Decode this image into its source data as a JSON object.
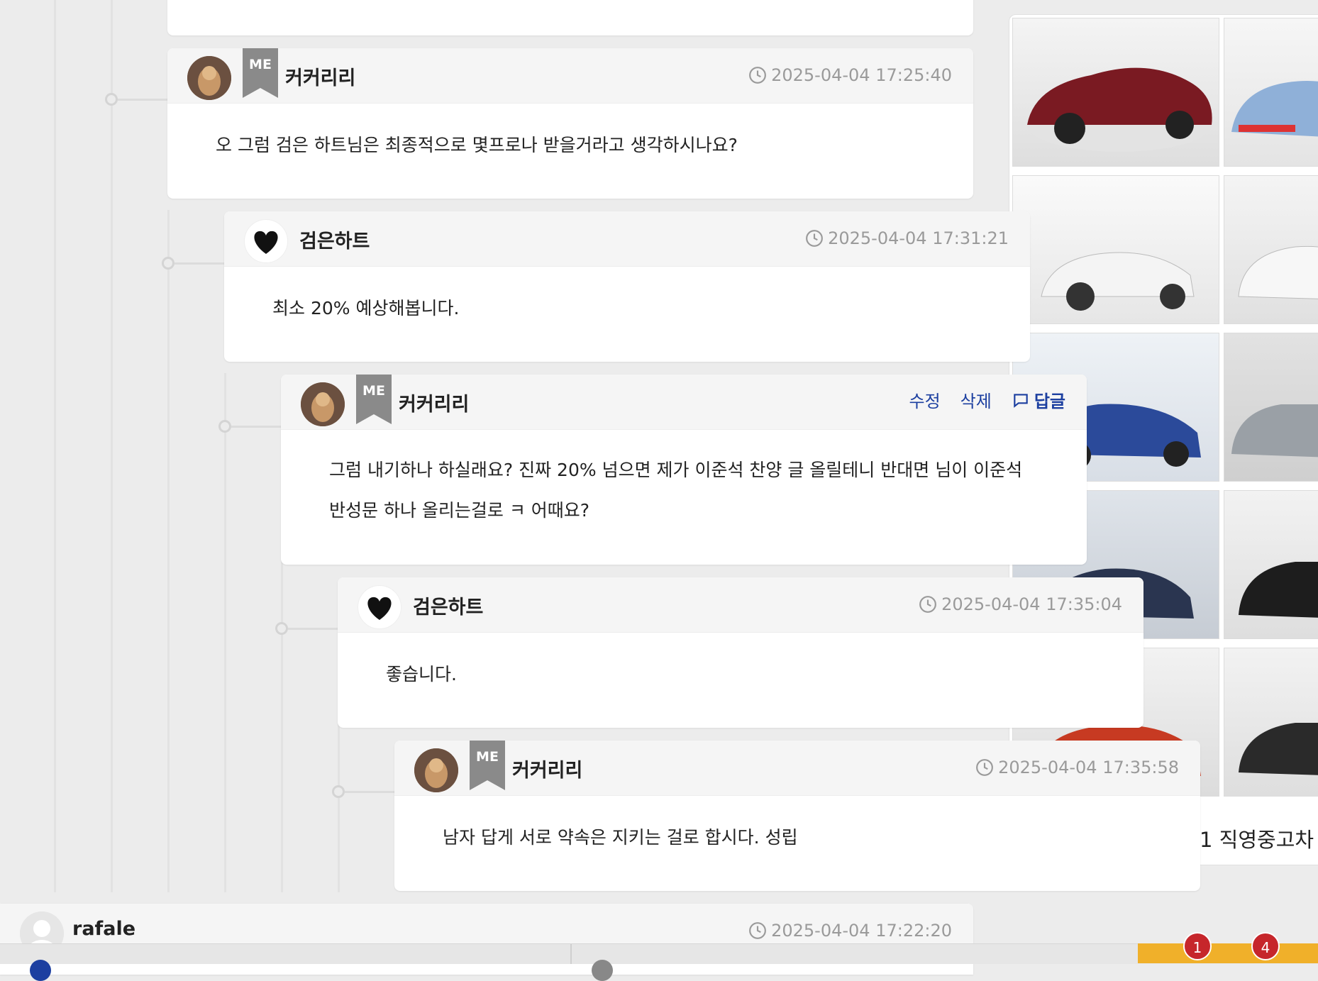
{
  "comments": [
    {
      "user": "커커리리",
      "is_me": true,
      "time": "2025-04-04 17:25:40",
      "text": "오 그럼 검은 하트님은 최종적으로 몇프로나 받을거라고 생각하시나요?"
    },
    {
      "user": "검은하트",
      "is_me": false,
      "time": "2025-04-04 17:31:21",
      "text": "최소 20% 예상해봅니다."
    },
    {
      "user": "커커리리",
      "is_me": true,
      "text": "그럼 내기하나 하실래요? 진짜 20% 넘으면 제가 이준석 찬양 글 올릴테니 반대면 님이 이준석 반성문 하나 올리는걸로 ㅋ 어때요?",
      "actions": {
        "edit": "수정",
        "delete": "삭제",
        "reply": "답글"
      }
    },
    {
      "user": "검은하트",
      "is_me": false,
      "time": "2025-04-04 17:35:04",
      "text": "좋습니다."
    },
    {
      "user": "커커리리",
      "is_me": true,
      "time": "2025-04-04 17:35:58",
      "text": "남자 답게 서로 약속은 지키는 걸로 합시다. 성립"
    }
  ],
  "next_comment": {
    "user": "rafale",
    "time": "2025-04-04 17:22:20"
  },
  "me_badge": "ME",
  "gallery": {
    "caption": "1 직영중고차"
  },
  "notifications": [
    {
      "count": "1"
    },
    {
      "count": "4"
    }
  ],
  "colors": {
    "accent": "#1c3fa0",
    "badge": "#8a8a8a",
    "notify": "#c6262b",
    "bar": "#f0b02a"
  }
}
